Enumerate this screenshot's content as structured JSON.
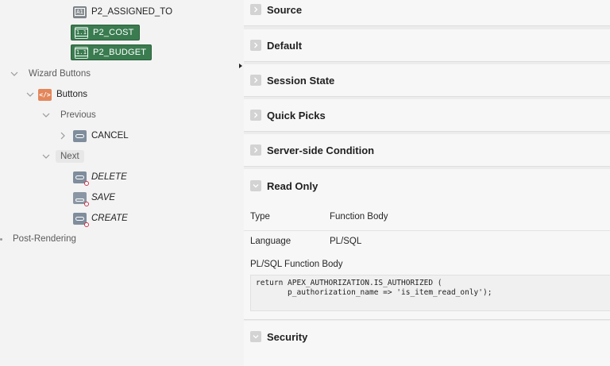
{
  "tree": {
    "items": [
      {
        "label": "P2_ASSIGNED_TO",
        "icon": "text-item-icon",
        "selected": false
      },
      {
        "label": "P2_COST",
        "icon": "number-item-icon",
        "selected": true
      },
      {
        "label": "P2_BUDGET",
        "icon": "number-item-icon",
        "selected": true
      }
    ],
    "wizard_buttons": "Wizard Buttons",
    "buttons": "Buttons",
    "previous": "Previous",
    "cancel": "CANCEL",
    "next": "Next",
    "delete": "DELETE",
    "save": "SAVE",
    "create": "CREATE",
    "post_rendering": "Post-Rendering"
  },
  "properties": {
    "groups": {
      "source": "Source",
      "default": "Default",
      "session_state": "Session State",
      "quick_picks": "Quick Picks",
      "server_side_condition": "Server-side Condition",
      "read_only": "Read Only",
      "security": "Security"
    },
    "read_only": {
      "type_label": "Type",
      "type_value": "Function Body",
      "language_label": "Language",
      "language_value": "PL/SQL",
      "body_label": "PL/SQL Function Body",
      "body_code": "return APEX_AUTHORIZATION.IS_AUTHORIZED (\n       p_authorization_name => 'is_item_read_only');"
    }
  },
  "colors": {
    "selected_bg": "#3a7c50",
    "panel_bg": "#f7f7f7",
    "code_icon": "#e3875b",
    "badge_ring": "#c8334d"
  }
}
